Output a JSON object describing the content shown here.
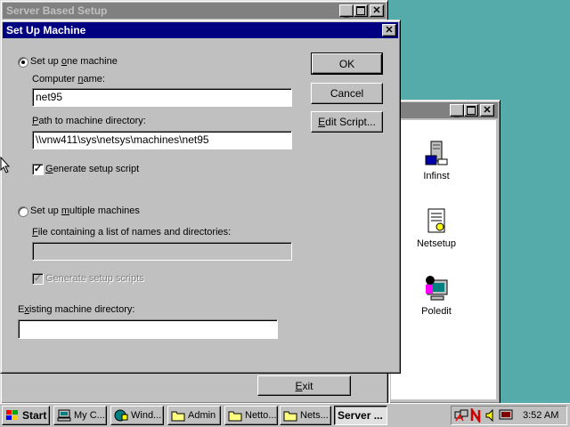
{
  "background_window": {
    "title": "Server Based Setup",
    "exit_label": "Exit"
  },
  "explorer_window": {
    "icons": [
      {
        "label": "Infinst",
        "icon": "computer-install-icon"
      },
      {
        "label": "Netsetup",
        "icon": "document-icon"
      },
      {
        "label": "Poledit",
        "icon": "policy-editor-icon"
      }
    ]
  },
  "dialog": {
    "title": "Set Up Machine",
    "radio_one": {
      "pre": "Set up ",
      "u": "o",
      "post": "ne machine",
      "selected": true
    },
    "computer_name_label": {
      "pre": "Computer ",
      "u": "n",
      "post": "ame:"
    },
    "computer_name_value": "net95",
    "path_label": {
      "pre": "",
      "u": "P",
      "post": "ath to machine directory:"
    },
    "path_value": "\\\\vnw411\\sys\\netsys\\machines\\net95",
    "gen_script": {
      "pre": "",
      "u": "G",
      "post": "enerate setup script",
      "checked": true
    },
    "radio_multi": {
      "pre": "Set up ",
      "u": "m",
      "post": "ultiple machines",
      "selected": false
    },
    "file_label": {
      "pre": "",
      "u": "F",
      "post": "ile containing a list of names and directories:"
    },
    "file_value": "",
    "gen_scripts": {
      "label": "Generate setup scripts",
      "checked": true,
      "disabled": true
    },
    "existing_label": {
      "pre": "E",
      "u": "x",
      "post": "isting machine directory:"
    },
    "existing_value": "",
    "ok_label": "OK",
    "cancel_label": "Cancel",
    "edit_script": {
      "pre": "",
      "u": "E",
      "post": "dit Script..."
    }
  },
  "taskbar": {
    "start_label": "Start",
    "buttons": [
      {
        "label": "My C...",
        "icon": "my-computer-icon"
      },
      {
        "label": "Wind...",
        "icon": "windows-explorer-icon"
      },
      {
        "label": "Admin",
        "icon": "folder-icon"
      },
      {
        "label": "Netto...",
        "icon": "folder-icon"
      },
      {
        "label": "Nets...",
        "icon": "folder-icon"
      },
      {
        "label": "Server ...",
        "icon": "",
        "active": true
      }
    ],
    "clock": "3:52 AM"
  }
}
